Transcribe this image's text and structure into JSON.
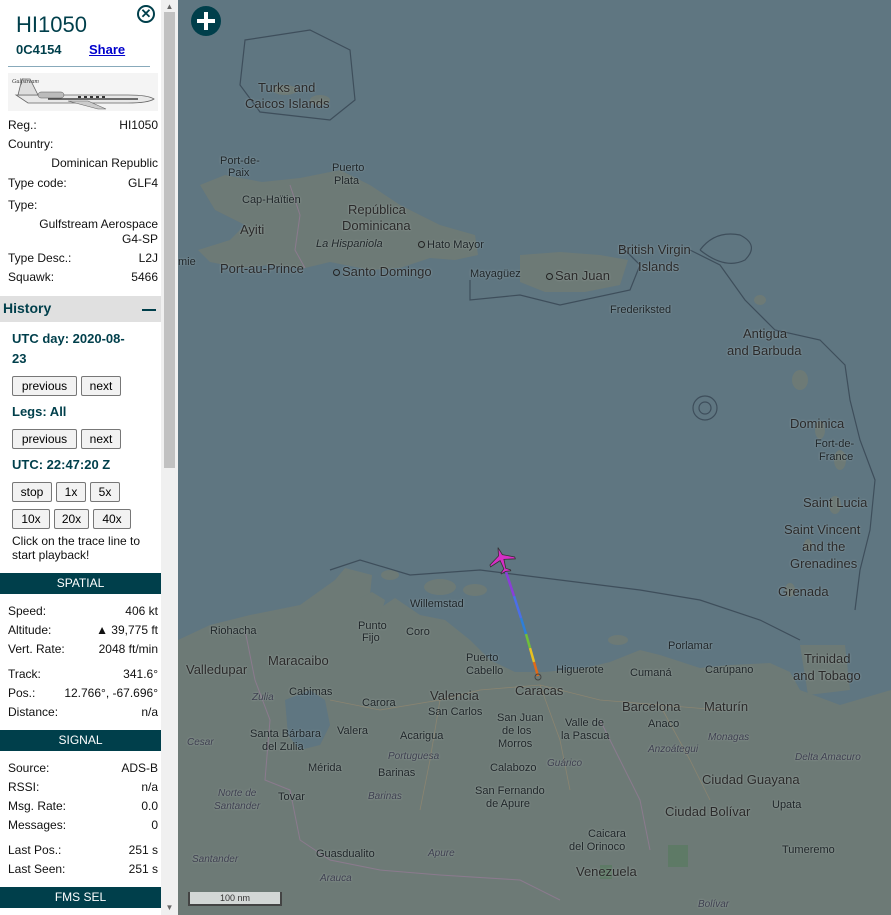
{
  "aircraft": {
    "callsign": "HI1050",
    "hex": "0C4154",
    "share_label": "Share",
    "photo_brand": "Gulfstream"
  },
  "details": {
    "reg_label": "Reg.:",
    "reg": "HI1050",
    "country_label": "Country:",
    "country": "Dominican Republic",
    "typecode_label": "Type code:",
    "typecode": "GLF4",
    "type_label": "Type:",
    "type_line1": "Gulfstream Aerospace",
    "type_line2": "G4-SP",
    "typedesc_label": "Type Desc.:",
    "typedesc": "L2J",
    "squawk_label": "Squawk:",
    "squawk": "5466"
  },
  "history": {
    "title": "History",
    "utc_day_line1": "UTC day: 2020-08-",
    "utc_day_line2": "23",
    "previous": "previous",
    "next": "next",
    "legs": "Legs: All",
    "utc_time": "UTC: 22:47:20 Z",
    "stop": "stop",
    "x1": "1x",
    "x5": "5x",
    "x10": "10x",
    "x20": "20x",
    "x40": "40x",
    "note": "Click on the trace line to start playback!"
  },
  "spatial": {
    "title": "SPATIAL",
    "speed_label": "Speed:",
    "speed": "406 kt",
    "alt_label": "Altitude:",
    "alt": "▲ 39,775 ft",
    "vrate_label": "Vert. Rate:",
    "vrate": "2048 ft/min",
    "track_label": "Track:",
    "track": "341.6°",
    "pos_label": "Pos.:",
    "pos": "12.766°, -67.696°",
    "dist_label": "Distance:",
    "dist": "n/a"
  },
  "signal": {
    "title": "SIGNAL",
    "source_label": "Source:",
    "source": "ADS-B",
    "rssi_label": "RSSI:",
    "rssi": "n/a",
    "msgrate_label": "Msg. Rate:",
    "msgrate": "0.0",
    "messages_label": "Messages:",
    "messages": "0",
    "lastpos_label": "Last Pos.:",
    "lastpos": "251 s",
    "lastseen_label": "Last Seen:",
    "lastseen": "251 s"
  },
  "fms": {
    "title": "FMS SEL"
  },
  "map": {
    "scale": "100 nm",
    "labels": {
      "turks": "Turks and",
      "caicos": "Caicos Islands",
      "portdepaix1": "Port-de-",
      "portdepaix2": "Paix",
      "puertoplata1": "Puerto",
      "puertoplata2": "Plata",
      "caphaitien": "Cap-Haïtien",
      "repdom1": "República",
      "repdom2": "Dominicana",
      "ayiti": "Ayiti",
      "hispaniola": "La Hispaniola",
      "hatomayor": "Hato Mayor",
      "mie": "mie",
      "portauprince": "Port-au-Prince",
      "santodomingo": "Santo Domingo",
      "mayaguez": "Mayagüez",
      "sanjuan": "San Juan",
      "bvi1": "British Virgin",
      "bvi2": "Islands",
      "frederiksted": "Frederiksted",
      "antigua1": "Antigua",
      "antigua2": "and Barbuda",
      "dominica": "Dominica",
      "fortdefrance1": "Fort-de-",
      "fortdefrance2": "France",
      "stlucia": "Saint Lucia",
      "stvincent1": "Saint Vincent",
      "stvincent2": "and the",
      "stvincent3": "Grenadines",
      "grenada": "Grenada",
      "willemstad": "Willemstad",
      "riohacha": "Riohacha",
      "puntofijo1": "Punto",
      "puntofijo2": "Fijo",
      "coro": "Coro",
      "porlamar": "Porlamar",
      "valledupar": "Valledupar",
      "maracaibo": "Maracaibo",
      "puertocabello1": "Puerto",
      "puertocabello2": "Cabello",
      "higuerote": "Higuerote",
      "cumana": "Cumaná",
      "carupano": "Carúpano",
      "trinidad1": "Trinidad",
      "trinidad2": "and Tobago",
      "caracas": "Caracas",
      "zulia": "Zulia",
      "cabimas": "Cabimas",
      "carora": "Carora",
      "valencia": "Valencia",
      "barcelona": "Barcelona",
      "maturin": "Maturín",
      "sancarlos": "San Carlos",
      "anaco": "Anaco",
      "cesar": "Cesar",
      "sbarbara1": "Santa Bárbara",
      "sbarbara2": "del Zulia",
      "valera": "Valera",
      "acarigua": "Acarigua",
      "sanjuanmorros1": "San Juan",
      "sanjuanmorros2": "de los",
      "sanjuanmorros3": "Morros",
      "valledelapascua1": "Valle de",
      "valledelapascua2": "la Pascua",
      "anzoategui": "Anzoátegui",
      "monagas": "Monagas",
      "portuguesa": "Portuguesa",
      "merida": "Mérida",
      "barinas_city": "Barinas",
      "calabozo": "Calabozo",
      "guarico": "Guárico",
      "deltaamacuro": "Delta Amacuro",
      "ciudadguayana": "Ciudad Guayana",
      "tovar": "Tovar",
      "barinas": "Barinas",
      "sanfernando1": "San Fernando",
      "sanfernando2": "de Apure",
      "ciudadbolivar": "Ciudad Bolívar",
      "upata": "Upata",
      "nortesantander1": "Norte de",
      "nortesantander2": "Santander",
      "caicara1": "Caicara",
      "caicara2": "del Orinoco",
      "santander": "Santander",
      "guasdualito": "Guasdualito",
      "apure": "Apure",
      "tumeremo": "Tumeremo",
      "venezuela": "Venezuela",
      "arauca": "Arauca",
      "bolivar": "Bolívar"
    }
  }
}
